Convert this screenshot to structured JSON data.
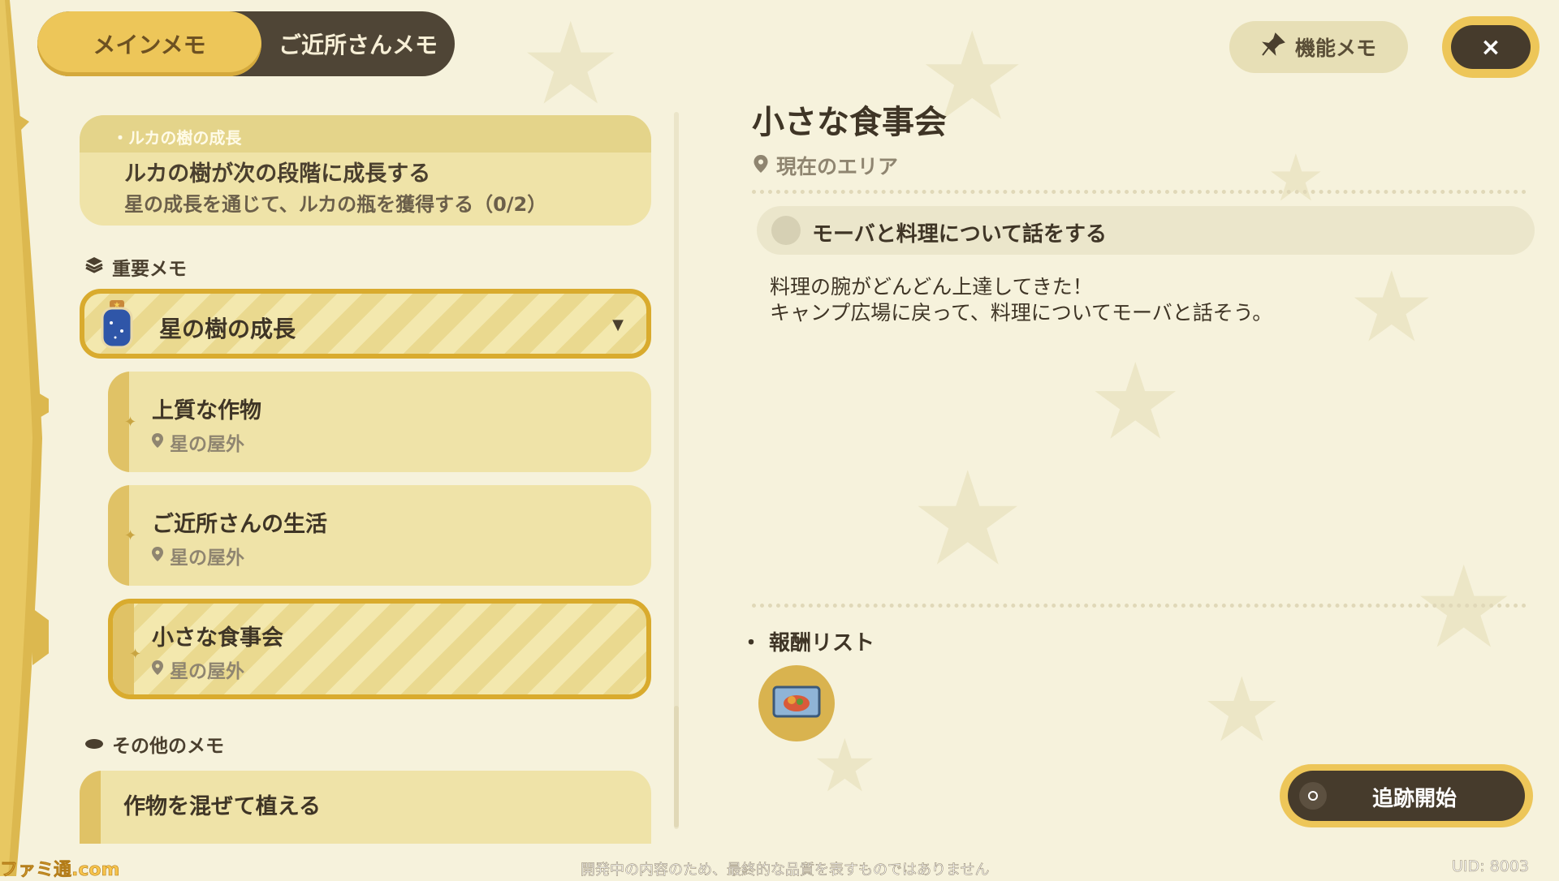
{
  "tabs": {
    "main": "メインメモ",
    "neighbor": "ご近所さんメモ"
  },
  "top_right": {
    "feature_memo": "機能メモ",
    "close_icon": "×",
    "feature_icon": "pin-icon"
  },
  "growth_card": {
    "subtitle": "・ルカの樹の成長",
    "title": "ルカの樹が次の段階に成長する",
    "description": "星の成長を通じて、ルカの瓶を獲得する（0/2）"
  },
  "sections": {
    "important": "重要メモ",
    "other": "その他のメモ"
  },
  "important_item": {
    "label": "星の樹の成長",
    "icon": "star-jar-icon"
  },
  "sub_items": [
    {
      "title": "上質な作物",
      "location": "星の屋外"
    },
    {
      "title": "ご近所さんの生活",
      "location": "星の屋外"
    },
    {
      "title": "小さな食事会",
      "location": "星の屋外"
    }
  ],
  "other_items": [
    {
      "title": "作物を混ぜて植える"
    }
  ],
  "detail": {
    "title": "小さな食事会",
    "area": "現在のエリア",
    "objective": "モーバと料理について話をする",
    "description": "料理の腕がどんどん上達してきた！\nキャンプ広場に戻って、料理についてモーバと話そう。",
    "reward_label": "・ 報酬リスト",
    "reward_icon": "recipe-scroll-icon"
  },
  "track_button": "追跡開始",
  "footer_note": "開発中の内容のため、最終的な品質を表すものではありません",
  "uid": "UID: 8003",
  "watermark": "ファミ通.com",
  "colors": {
    "accent": "#edc659",
    "dark": "#463b2c",
    "background": "#f6f2dc",
    "card": "#efe3a8"
  }
}
